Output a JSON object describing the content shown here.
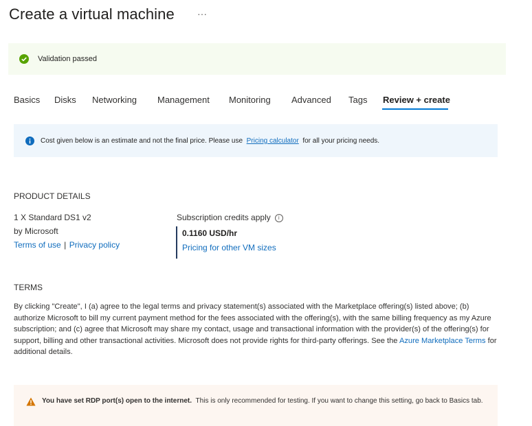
{
  "page": {
    "title": "Create a virtual machine",
    "more_label": "···"
  },
  "validation": {
    "text": "Validation passed",
    "color": "#57a300"
  },
  "tabs": [
    {
      "label": "Basics"
    },
    {
      "label": "Disks"
    },
    {
      "label": "Networking"
    },
    {
      "label": "Management"
    },
    {
      "label": "Monitoring"
    },
    {
      "label": "Advanced"
    },
    {
      "label": "Tags"
    },
    {
      "label": "Review + create",
      "active": true
    }
  ],
  "info_banner": {
    "text_before": "Cost given below is an estimate and not the final price. Please use",
    "link": "Pricing calculator",
    "text_after": "for all your pricing needs."
  },
  "product_details": {
    "heading": "PRODUCT DETAILS",
    "product_name": "1 X Standard DS1 v2",
    "publisher": "by Microsoft",
    "terms_link": "Terms of use",
    "separator": "|",
    "privacy_link": "Privacy policy",
    "credits_label": "Subscription credits apply",
    "credits_info_glyph": "i",
    "price": "0.1160 USD/hr",
    "other_sizes_link": "Pricing for other VM sizes"
  },
  "terms": {
    "heading": "TERMS",
    "body": "By clicking \"Create\", I (a) agree to the legal terms and privacy statement(s) associated with the Marketplace offering(s) listed above; (b) authorize Microsoft to bill my current payment method for the fees associated with the offering(s), with the same billing frequency as my Azure subscription; and (c) agree that Microsoft may share my contact, usage and transactional information with the provider(s) of the offering(s) for support, billing and other transactional activities. Microsoft does not provide rights for third-party offerings. See the",
    "link": "Azure Marketplace Terms",
    "suffix": "for additional details."
  },
  "warning": {
    "bold": "You have set RDP port(s) open to the internet.",
    "text": "This is only recommended for testing.  If you want to change this setting, go back to Basics tab.",
    "color": "#d47500"
  }
}
